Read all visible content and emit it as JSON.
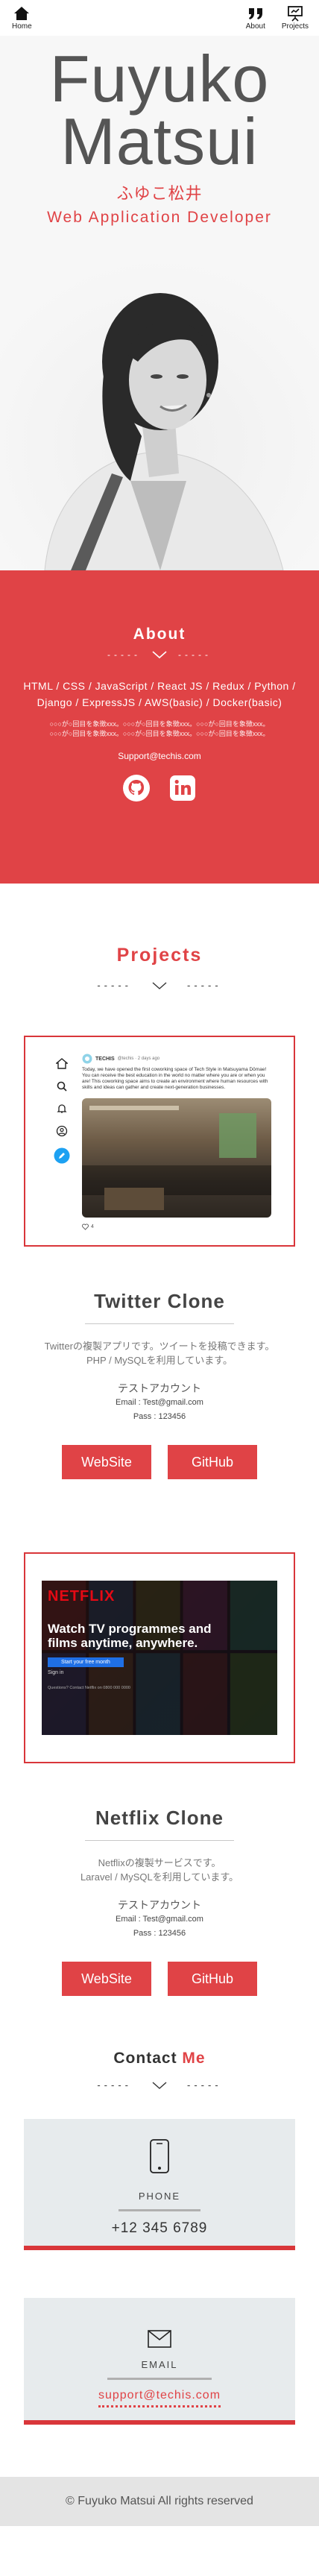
{
  "nav": {
    "home": {
      "label": "Home",
      "icon": "home-icon"
    },
    "about": {
      "label": "About",
      "icon": "quote-icon"
    },
    "projects": {
      "label": "Projects",
      "icon": "presentation-icon"
    }
  },
  "hero": {
    "name_line1": "Fuyuko",
    "name_line2": "Matsui",
    "kana": "ふゆこ松井",
    "role": "Web Application Developer"
  },
  "about": {
    "title": "About",
    "skills_line1": "HTML / CSS / JavaScript / React JS / Redux / Python /",
    "skills_line2": "Django / ExpressJS / AWS(basic) / Docker(basic)",
    "placeholder_line1": "○○○が○回目を象徴xxx。○○○が○回目を象徴xxx。○○○が○回目を象徴xxx。",
    "placeholder_line2": "○○○が○回目を象徴xxx。○○○が○回目を象徴xxx。○○○が○回目を象徴xxx。",
    "email": "Support@techis.com",
    "socials": [
      {
        "icon": "github-icon"
      },
      {
        "icon": "linkedin-icon"
      }
    ]
  },
  "projects": {
    "title": "Projects",
    "items": [
      {
        "title": "Twitter Clone",
        "desc_line1": "Twitterの複製アプリです。ツイートを投稿できます。",
        "desc_line2": "PHP / MySQLを利用しています。",
        "account_title": "テストアカウント",
        "email": "Email : Test@gmail.com",
        "pass": "Pass : 123456",
        "website_label": "WebSite",
        "github_label": "GitHub",
        "mock": {
          "user": "TECHIS",
          "handle": "@techis · 2 days ago",
          "text": "Today, we have opened the first coworking space of Tech Style in Matsuyama Dōmae! You can receive the best education in the world no matter where you are or when you are! This coworking space aims to create an environment where human resources with skills and ideas can gather and create next-generation businesses.",
          "likes": "4"
        }
      },
      {
        "title": "Netflix Clone",
        "desc_line1": "Netflixの複製サービスです。",
        "desc_line2": "Laravel / MySQLを利用しています。",
        "account_title": "テストアカウント",
        "email": "Email : Test@gmail.com",
        "pass": "Pass : 123456",
        "website_label": "WebSite",
        "github_label": "GitHub",
        "mock": {
          "brand": "NETFLIX",
          "headline": "Watch TV programmes and films anytime, anywhere.",
          "cta": "Start your free month",
          "signin": "Sign in",
          "footer": "Questions? Contact Netflix on 0800 000 0000"
        }
      }
    ]
  },
  "contact": {
    "title_a": "Contact",
    "title_b": "Me",
    "phone_label": "PHONE",
    "phone_value": "+12 345 6789",
    "email_label": "EMAIL",
    "email_value": "support@techis.com"
  },
  "footer": {
    "text": "© Fuyuko Matsui All rights reserved"
  },
  "colors": {
    "accent": "#e04346"
  }
}
